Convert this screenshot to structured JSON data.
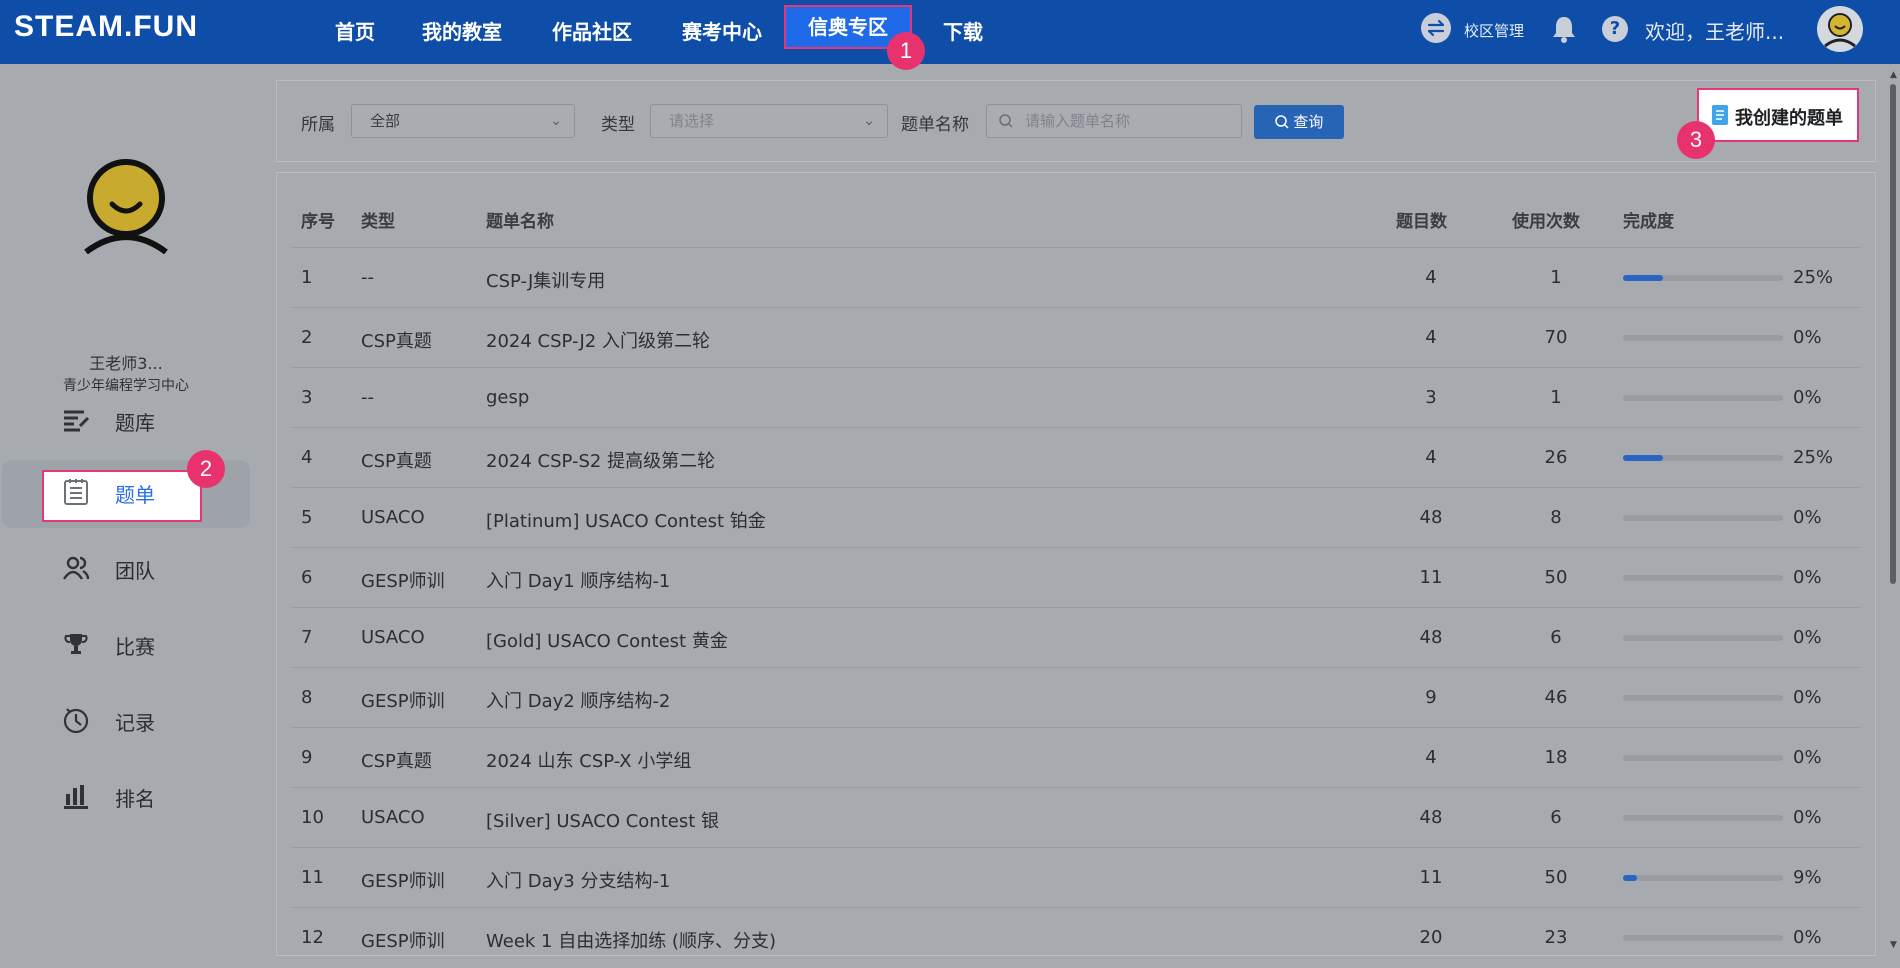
{
  "header": {
    "logo": "STEAM.FUN",
    "nav": [
      {
        "label": "首页"
      },
      {
        "label": "我的教室"
      },
      {
        "label": "作品社区"
      },
      {
        "label": "赛考中心"
      },
      {
        "label": "信奥专区",
        "active": true
      },
      {
        "label": "下载"
      }
    ],
    "campus_label": "校区管理",
    "welcome": "欢迎，王老师..."
  },
  "badges": {
    "one": "1",
    "two": "2",
    "three": "3"
  },
  "sidebar": {
    "user_name": "王老师3...",
    "user_org": "青少年编程学习中心",
    "items": [
      {
        "label": "题库",
        "icon": "question-bank-icon"
      },
      {
        "label": "题单",
        "icon": "checklist-icon",
        "active": true
      },
      {
        "label": "团队",
        "icon": "team-icon"
      },
      {
        "label": "比赛",
        "icon": "trophy-icon"
      },
      {
        "label": "记录",
        "icon": "history-icon"
      },
      {
        "label": "排名",
        "icon": "ranking-icon"
      }
    ]
  },
  "filters": {
    "belong_label": "所属",
    "belong_value": "全部",
    "type_label": "类型",
    "type_placeholder": "请选择",
    "name_label": "题单名称",
    "name_placeholder": "请输入题单名称",
    "query_label": "查询"
  },
  "my_lists_button": "我创建的题单",
  "table": {
    "headers": [
      "序号",
      "类型",
      "题单名称",
      "题目数",
      "使用次数",
      "完成度"
    ],
    "rows": [
      {
        "no": "1",
        "type": "--",
        "name": "CSP-J集训专用",
        "count": "4",
        "uses": "1",
        "progress": 25,
        "pct": "25%"
      },
      {
        "no": "2",
        "type": "CSP真题",
        "name": "2024 CSP-J2 入门级第二轮",
        "count": "4",
        "uses": "70",
        "progress": 0,
        "pct": "0%"
      },
      {
        "no": "3",
        "type": "--",
        "name": "gesp",
        "count": "3",
        "uses": "1",
        "progress": 0,
        "pct": "0%"
      },
      {
        "no": "4",
        "type": "CSP真题",
        "name": "2024 CSP-S2 提高级第二轮",
        "count": "4",
        "uses": "26",
        "progress": 25,
        "pct": "25%"
      },
      {
        "no": "5",
        "type": "USACO",
        "name": "[Platinum] USACO Contest 铂金",
        "count": "48",
        "uses": "8",
        "progress": 0,
        "pct": "0%"
      },
      {
        "no": "6",
        "type": "GESP师训",
        "name": "入门 Day1 顺序结构-1",
        "count": "11",
        "uses": "50",
        "progress": 0,
        "pct": "0%"
      },
      {
        "no": "7",
        "type": "USACO",
        "name": "[Gold] USACO Contest 黄金",
        "count": "48",
        "uses": "6",
        "progress": 0,
        "pct": "0%"
      },
      {
        "no": "8",
        "type": "GESP师训",
        "name": "入门 Day2 顺序结构-2",
        "count": "9",
        "uses": "46",
        "progress": 0,
        "pct": "0%"
      },
      {
        "no": "9",
        "type": "CSP真题",
        "name": "2024 山东 CSP-X 小学组",
        "count": "4",
        "uses": "18",
        "progress": 0,
        "pct": "0%"
      },
      {
        "no": "10",
        "type": "USACO",
        "name": "[Silver] USACO Contest 银",
        "count": "48",
        "uses": "6",
        "progress": 0,
        "pct": "0%"
      },
      {
        "no": "11",
        "type": "GESP师训",
        "name": "入门 Day3 分支结构-1",
        "count": "11",
        "uses": "50",
        "progress": 9,
        "pct": "9%"
      },
      {
        "no": "12",
        "type": "GESP师训",
        "name": "Week 1 自由选择加练 (顺序、分支)",
        "count": "20",
        "uses": "23",
        "progress": 0,
        "pct": "0%"
      }
    ]
  },
  "colors": {
    "topbar": "#0f4ea8",
    "accent": "#2a6ee8",
    "highlight_border": "#e6367a",
    "progress": "#2964c2"
  }
}
